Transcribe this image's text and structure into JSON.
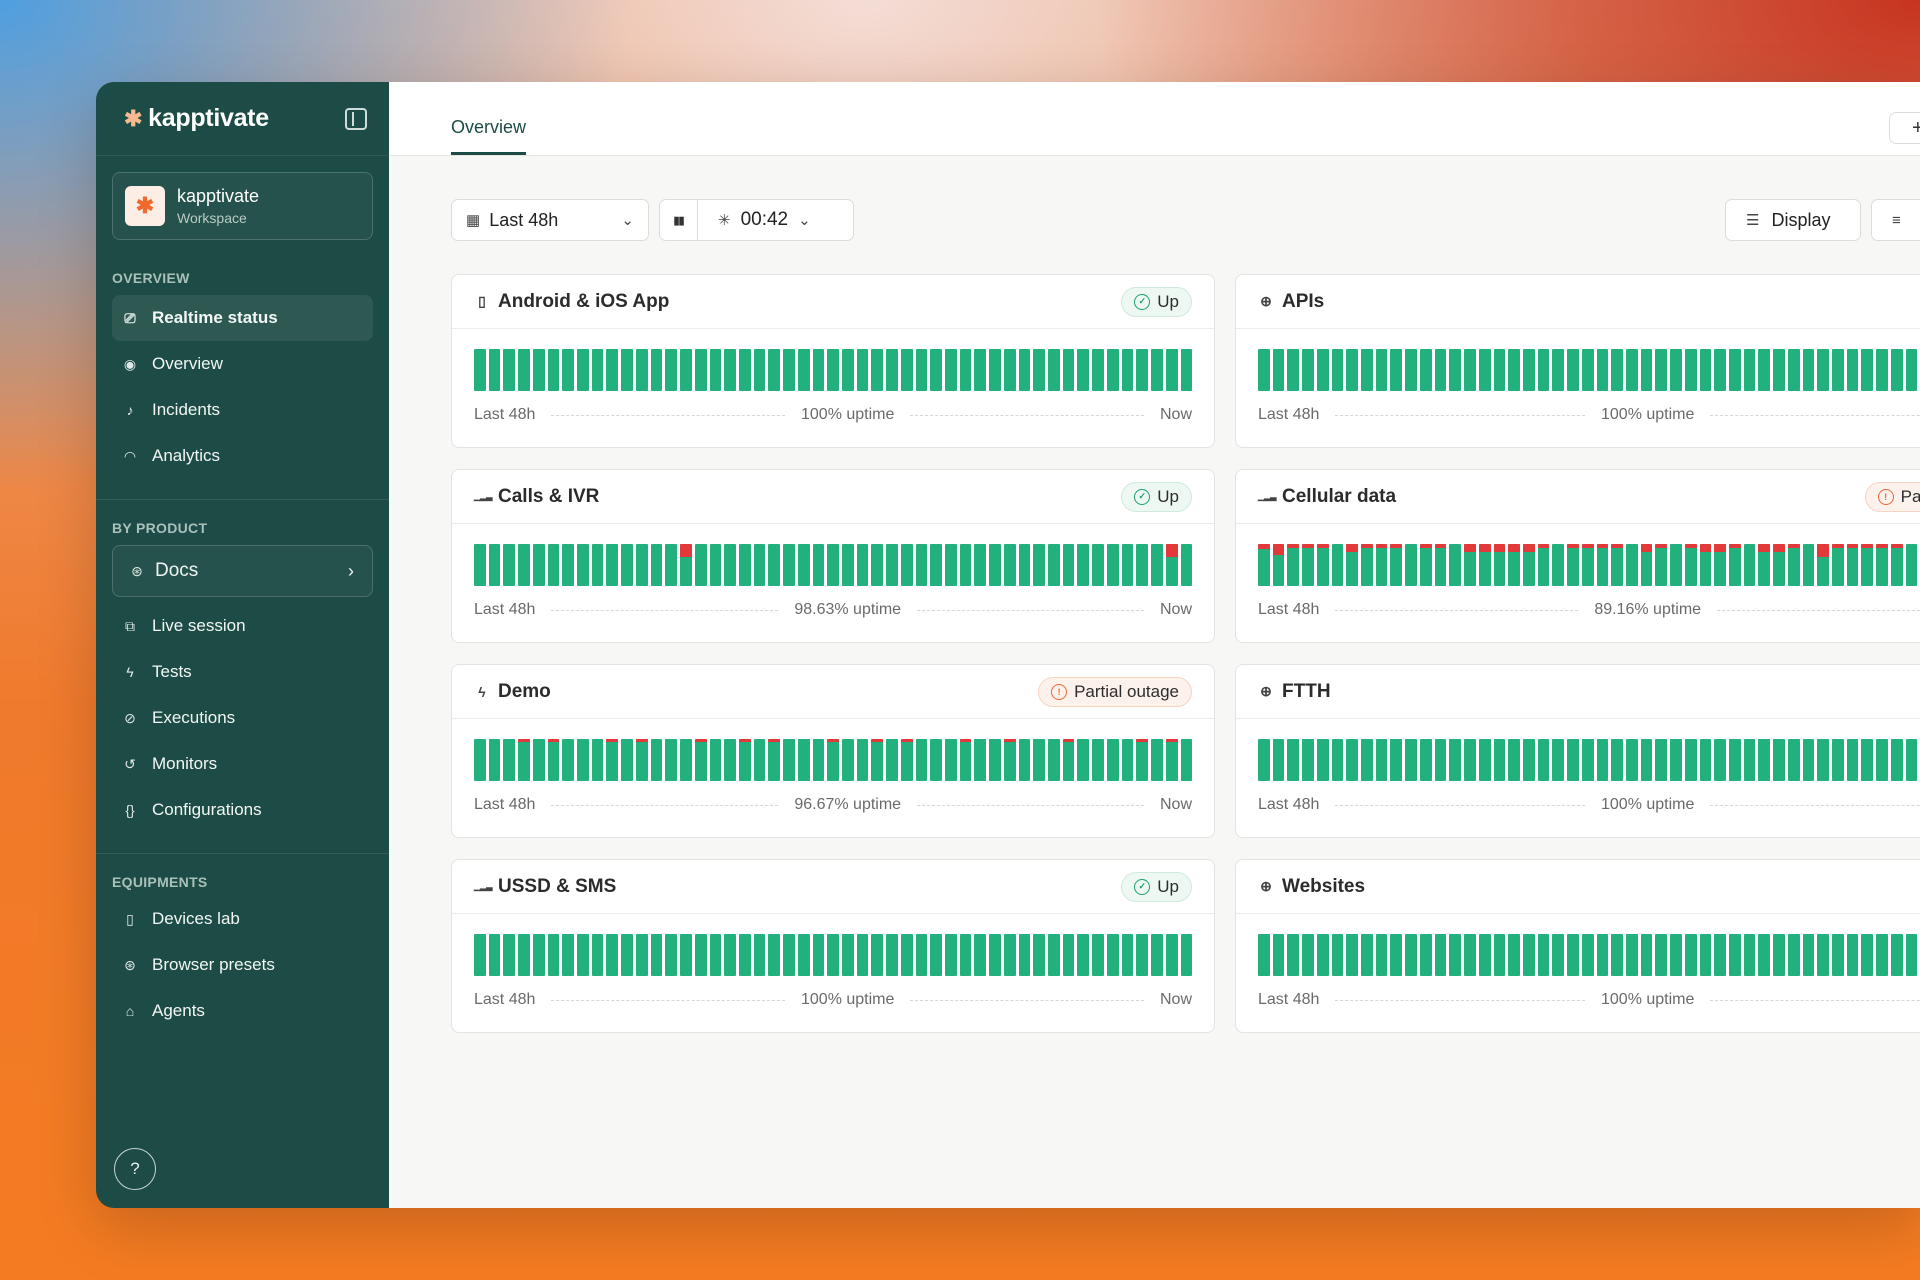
{
  "app": {
    "brand": "kapptivate",
    "collapse_icon": "sidebar-collapse-icon"
  },
  "workspace": {
    "name": "kapptivate",
    "subtitle": "Workspace",
    "avatar_glyph": "✱"
  },
  "sidebar": {
    "overview_label": "OVERVIEW",
    "overview_items": [
      {
        "label": "Realtime status",
        "icon": "⎚",
        "active": true
      },
      {
        "label": "Overview",
        "icon": "◉"
      },
      {
        "label": "Incidents",
        "icon": "♪"
      },
      {
        "label": "Analytics",
        "icon": "◠"
      }
    ],
    "product_label": "BY PRODUCT",
    "product_selector": "Docs",
    "product_items": [
      {
        "label": "Live session",
        "icon": "⧉"
      },
      {
        "label": "Tests",
        "icon": "ϟ"
      },
      {
        "label": "Executions",
        "icon": "⊘"
      },
      {
        "label": "Monitors",
        "icon": "↺"
      },
      {
        "label": "Configurations",
        "icon": "{}"
      }
    ],
    "equipment_label": "EQUIPMENTS",
    "equipment_items": [
      {
        "label": "Devices lab",
        "icon": "▯"
      },
      {
        "label": "Browser presets",
        "icon": "⊛"
      },
      {
        "label": "Agents",
        "icon": "⌂"
      }
    ],
    "help_label": "?"
  },
  "header": {
    "tab": "Overview",
    "plus_label": "+"
  },
  "toolbar": {
    "range": "Last 48h",
    "timer": "00:42",
    "display_label": "Display"
  },
  "colors": {
    "up": "#22b07d",
    "down": "#e23a3a",
    "sidebar": "#1d4b45"
  },
  "cards": [
    {
      "title": "Android & iOS App",
      "icon": "▯",
      "status": "Up",
      "status_type": "up",
      "uptime": "100% uptime",
      "range": "Last 48h",
      "end": "Now",
      "incidents": []
    },
    {
      "title": "APIs",
      "icon": "⊕",
      "status": "",
      "status_type": "up",
      "uptime": "100% uptime",
      "range": "Last 48h",
      "end": "",
      "incidents": []
    },
    {
      "title": "Calls & IVR",
      "icon": "▁▂▃",
      "status": "Up",
      "status_type": "up",
      "uptime": "98.63% uptime",
      "range": "Last 48h",
      "end": "Now",
      "incidents": [
        {
          "i": 14,
          "d": 0.3
        },
        {
          "i": 47,
          "d": 0.3
        }
      ]
    },
    {
      "title": "Cellular data",
      "icon": "▁▂▃",
      "status": "Partial o",
      "status_type": "partial",
      "uptime": "89.16% uptime",
      "range": "Last 48h",
      "end": "",
      "incidents": [
        {
          "i": 0,
          "d": 0.12
        },
        {
          "i": 1,
          "d": 0.25
        },
        {
          "i": 2,
          "d": 0.1
        },
        {
          "i": 3,
          "d": 0.1
        },
        {
          "i": 4,
          "d": 0.1
        },
        {
          "i": 6,
          "d": 0.2
        },
        {
          "i": 7,
          "d": 0.1
        },
        {
          "i": 8,
          "d": 0.1
        },
        {
          "i": 9,
          "d": 0.1
        },
        {
          "i": 11,
          "d": 0.1
        },
        {
          "i": 12,
          "d": 0.1
        },
        {
          "i": 14,
          "d": 0.2
        },
        {
          "i": 15,
          "d": 0.2
        },
        {
          "i": 16,
          "d": 0.2
        },
        {
          "i": 17,
          "d": 0.2
        },
        {
          "i": 18,
          "d": 0.2
        },
        {
          "i": 19,
          "d": 0.1
        },
        {
          "i": 21,
          "d": 0.1
        },
        {
          "i": 22,
          "d": 0.1
        },
        {
          "i": 23,
          "d": 0.1
        },
        {
          "i": 24,
          "d": 0.1
        },
        {
          "i": 26,
          "d": 0.2
        },
        {
          "i": 27,
          "d": 0.1
        },
        {
          "i": 29,
          "d": 0.1
        },
        {
          "i": 30,
          "d": 0.2
        },
        {
          "i": 31,
          "d": 0.2
        },
        {
          "i": 32,
          "d": 0.1
        },
        {
          "i": 34,
          "d": 0.2
        },
        {
          "i": 35,
          "d": 0.2
        },
        {
          "i": 36,
          "d": 0.1
        },
        {
          "i": 38,
          "d": 0.3
        },
        {
          "i": 39,
          "d": 0.1
        },
        {
          "i": 40,
          "d": 0.1
        },
        {
          "i": 41,
          "d": 0.1
        },
        {
          "i": 42,
          "d": 0.1
        },
        {
          "i": 43,
          "d": 0.1
        }
      ]
    },
    {
      "title": "Demo",
      "icon": "ϟ",
      "status": "Partial outage",
      "status_type": "partial",
      "uptime": "96.67% uptime",
      "range": "Last 48h",
      "end": "Now",
      "incidents": [
        {
          "i": 3,
          "d": 0.08
        },
        {
          "i": 5,
          "d": 0.08
        },
        {
          "i": 9,
          "d": 0.08
        },
        {
          "i": 11,
          "d": 0.08
        },
        {
          "i": 15,
          "d": 0.08
        },
        {
          "i": 18,
          "d": 0.08
        },
        {
          "i": 20,
          "d": 0.08
        },
        {
          "i": 24,
          "d": 0.08
        },
        {
          "i": 27,
          "d": 0.08
        },
        {
          "i": 29,
          "d": 0.08
        },
        {
          "i": 33,
          "d": 0.08
        },
        {
          "i": 36,
          "d": 0.08
        },
        {
          "i": 40,
          "d": 0.08
        },
        {
          "i": 45,
          "d": 0.08
        },
        {
          "i": 47,
          "d": 0.08
        }
      ]
    },
    {
      "title": "FTTH",
      "icon": "⊕",
      "status": "",
      "status_type": "up",
      "uptime": "100% uptime",
      "range": "Last 48h",
      "end": "",
      "incidents": []
    },
    {
      "title": "USSD & SMS",
      "icon": "▁▂▃",
      "status": "Up",
      "status_type": "up",
      "uptime": "100% uptime",
      "range": "Last 48h",
      "end": "Now",
      "incidents": []
    },
    {
      "title": "Websites",
      "icon": "⊕",
      "status": "",
      "status_type": "up",
      "uptime": "100% uptime",
      "range": "Last 48h",
      "end": "",
      "incidents": []
    }
  ]
}
